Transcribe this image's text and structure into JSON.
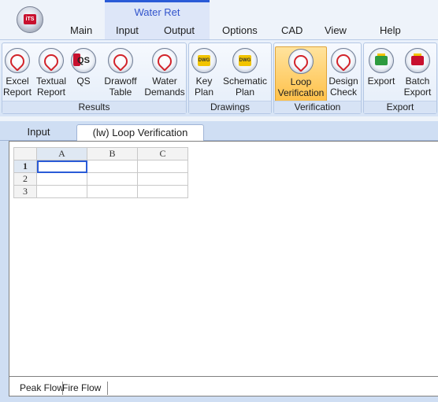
{
  "app": {
    "context_tab_title": "Water Ret",
    "logo_text": "iTS"
  },
  "menu": {
    "tabs": [
      {
        "label": "Main"
      },
      {
        "label": "Input"
      },
      {
        "label": "Output"
      },
      {
        "label": "Options"
      },
      {
        "label": "CAD"
      },
      {
        "label": "View"
      },
      {
        "label": "Help"
      }
    ]
  },
  "ribbon": {
    "groups": [
      {
        "caption": "Results",
        "buttons": [
          {
            "line1": "Excel",
            "line2": "Report",
            "icon": "pdf-icon"
          },
          {
            "line1": "Textual",
            "line2": "Report",
            "icon": "pdf-icon"
          },
          {
            "line1": "QS",
            "line2": "",
            "icon": "qs-icon"
          },
          {
            "line1": "Drawoff",
            "line2": "Table",
            "icon": "pdf-icon"
          },
          {
            "line1": "Water",
            "line2": "Demands",
            "icon": "pdf-icon"
          }
        ]
      },
      {
        "caption": "Drawings",
        "buttons": [
          {
            "line1": "Key",
            "line2": "Plan",
            "icon": "dwg-icon",
            "icon_text": "DWG"
          },
          {
            "line1": "Schematic",
            "line2": "Plan",
            "icon": "dwg-icon",
            "icon_text": "DWG"
          }
        ]
      },
      {
        "caption": "Verification",
        "buttons": [
          {
            "line1": "Loop",
            "line2": "Verification",
            "icon": "pdf-icon",
            "active": true
          },
          {
            "line1": "Design",
            "line2": "Check",
            "icon": "pdf-icon"
          }
        ]
      },
      {
        "caption": "Export",
        "buttons": [
          {
            "line1": "Export",
            "line2": "",
            "icon": "export-icon"
          },
          {
            "line1": "Batch",
            "line2": "Export",
            "icon": "batch-export-icon"
          }
        ]
      }
    ]
  },
  "document_tabs": [
    {
      "label": "Input",
      "selected": false
    },
    {
      "label": "(lw) Loop Verification",
      "selected": true
    }
  ],
  "grid": {
    "columns": [
      "A",
      "B",
      "C"
    ],
    "rows": [
      "1",
      "2",
      "3"
    ],
    "active_cell": "A1"
  },
  "sheet_tabs": [
    {
      "label": "Peak Flow",
      "selected": true
    },
    {
      "label": "Fire Flow",
      "selected": false
    }
  ],
  "colors": {
    "accent": "#2a5bd7",
    "active_button": "#ffc14a"
  }
}
